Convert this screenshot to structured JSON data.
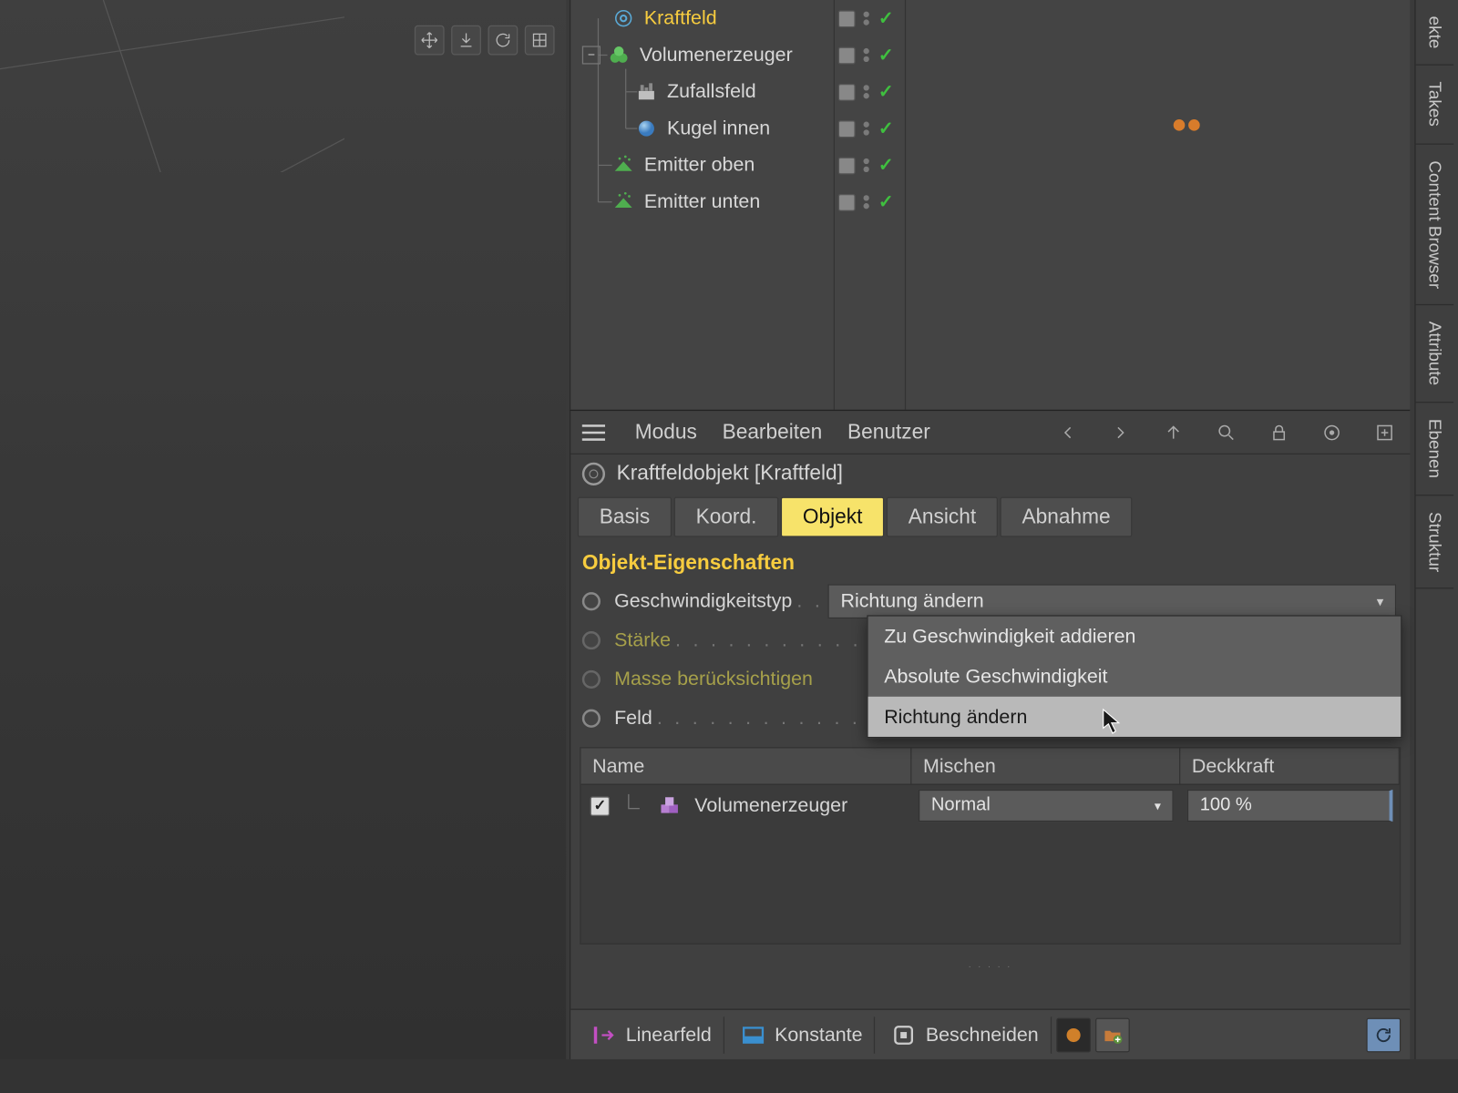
{
  "objects": {
    "items": [
      {
        "label": "Kraftfeld",
        "selected": true,
        "indent": 0
      },
      {
        "label": "Volumenerzeuger",
        "indent": 0,
        "expanded": true
      },
      {
        "label": "Zufallsfeld",
        "indent": 1
      },
      {
        "label": "Kugel innen",
        "indent": 1,
        "extraDots": true
      },
      {
        "label": "Emitter oben",
        "indent": 0
      },
      {
        "label": "Emitter unten",
        "indent": 0
      }
    ]
  },
  "attributeManager": {
    "menu": {
      "mode": "Modus",
      "edit": "Bearbeiten",
      "user": "Benutzer"
    },
    "title": "Kraftfeldobjekt [Kraftfeld]",
    "tabs": {
      "basis": "Basis",
      "koord": "Koord.",
      "objekt": "Objekt",
      "ansicht": "Ansicht",
      "abnahme": "Abnahme"
    },
    "sectionTitle": "Objekt-Eigenschaften",
    "props": {
      "velocityType": {
        "label": "Geschwindigkeitstyp",
        "value": "Richtung ändern"
      },
      "strength": {
        "label": "Stärke"
      },
      "considerMass": {
        "label": "Masse berücksichtigen"
      },
      "field": {
        "label": "Feld"
      }
    },
    "dropdownOptions": {
      "opt1": "Zu Geschwindigkeit addieren",
      "opt2": "Absolute Geschwindigkeit",
      "opt3": "Richtung ändern"
    },
    "fieldTable": {
      "headers": {
        "name": "Name",
        "mix": "Mischen",
        "opacity": "Deckkraft"
      },
      "row": {
        "name": "Volumenerzeuger",
        "mix": "Normal",
        "opacity": "100 %"
      }
    },
    "bottomBar": {
      "linear": "Linearfeld",
      "konstante": "Konstante",
      "beschneiden": "Beschneiden"
    }
  },
  "sideTabs": {
    "t1": "ekte",
    "t2": "Takes",
    "t3": "Content Browser",
    "t4": "Attribute",
    "t5": "Ebenen",
    "t6": "Struktur"
  }
}
